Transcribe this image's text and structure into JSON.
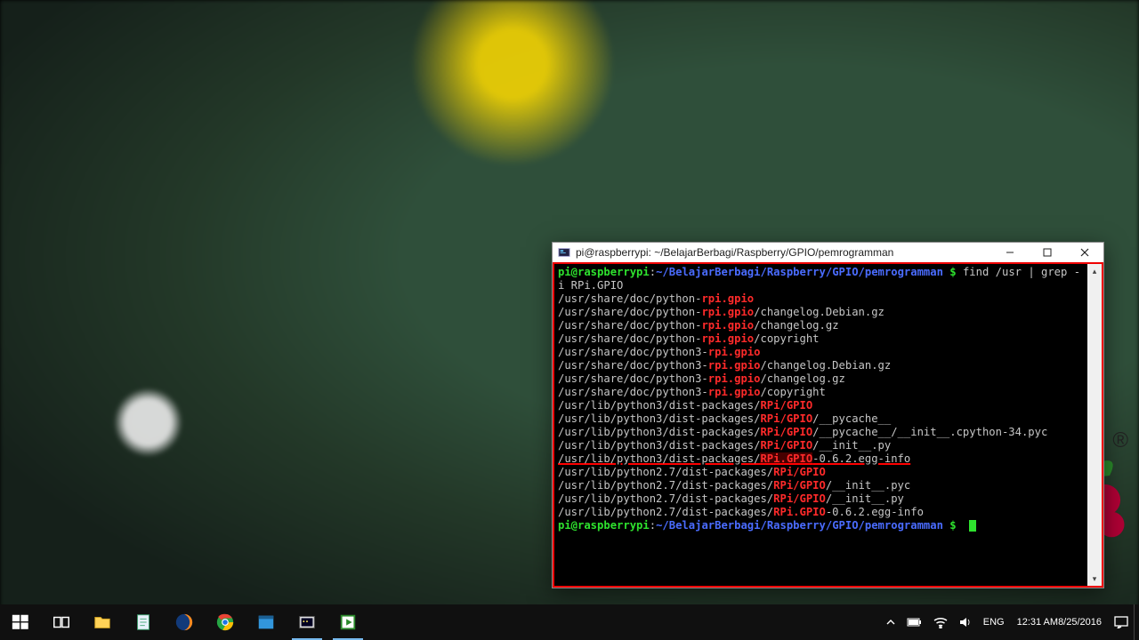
{
  "window": {
    "title": "pi@raspberrypi: ~/BelajarBerbagi/Raspberry/GPIO/pemrogramman"
  },
  "prompt": {
    "user_host": "pi@raspberrypi",
    "path": "~/BelajarBerbagi/Raspberry/GPIO/pemrogramman",
    "dollar": " $ "
  },
  "command": {
    "part1": "find /usr | grep -",
    "wrap": "i RPi.GPIO"
  },
  "lines": [
    {
      "pre": "/usr/share/doc/python-",
      "hi": "rpi.gpio",
      "post": ""
    },
    {
      "pre": "/usr/share/doc/python-",
      "hi": "rpi.gpio",
      "post": "/changelog.Debian.gz"
    },
    {
      "pre": "/usr/share/doc/python-",
      "hi": "rpi.gpio",
      "post": "/changelog.gz"
    },
    {
      "pre": "/usr/share/doc/python-",
      "hi": "rpi.gpio",
      "post": "/copyright"
    },
    {
      "pre": "/usr/share/doc/python3-",
      "hi": "rpi.gpio",
      "post": ""
    },
    {
      "pre": "/usr/share/doc/python3-",
      "hi": "rpi.gpio",
      "post": "/changelog.Debian.gz"
    },
    {
      "pre": "/usr/share/doc/python3-",
      "hi": "rpi.gpio",
      "post": "/changelog.gz"
    },
    {
      "pre": "/usr/share/doc/python3-",
      "hi": "rpi.gpio",
      "post": "/copyright"
    },
    {
      "pre": "/usr/lib/python3/dist-packages/",
      "hi": "RPi/GPIO",
      "post": ""
    },
    {
      "pre": "/usr/lib/python3/dist-packages/",
      "hi": "RPi/GPIO",
      "post": "/__pycache__"
    },
    {
      "pre": "/usr/lib/python3/dist-packages/",
      "hi": "RPi/GPIO",
      "post": "/__pycache__/__init__.cpython-34.pyc"
    },
    {
      "pre": "/usr/lib/python3/dist-packages/",
      "hi": "RPi/GPIO",
      "post": "/__init__.py"
    },
    {
      "pre": "/usr/lib/python3/dist-packages/",
      "hi": "RPi.GPIO",
      "post": "-0.6.2.egg-info",
      "mark": true
    },
    {
      "pre": "/usr/lib/python2.7/dist-packages/",
      "hi": "RPi/GPIO",
      "post": ""
    },
    {
      "pre": "/usr/lib/python2.7/dist-packages/",
      "hi": "RPi/GPIO",
      "post": "/__init__.pyc"
    },
    {
      "pre": "/usr/lib/python2.7/dist-packages/",
      "hi": "RPi/GPIO",
      "post": "/__init__.py"
    },
    {
      "pre": "/usr/lib/python2.7/dist-packages/",
      "hi": "RPi.GPIO",
      "post": "-0.6.2.egg-info"
    }
  ],
  "systray": {
    "lang": "ENG",
    "time": "12:31 AM",
    "date": "8/25/2016"
  }
}
